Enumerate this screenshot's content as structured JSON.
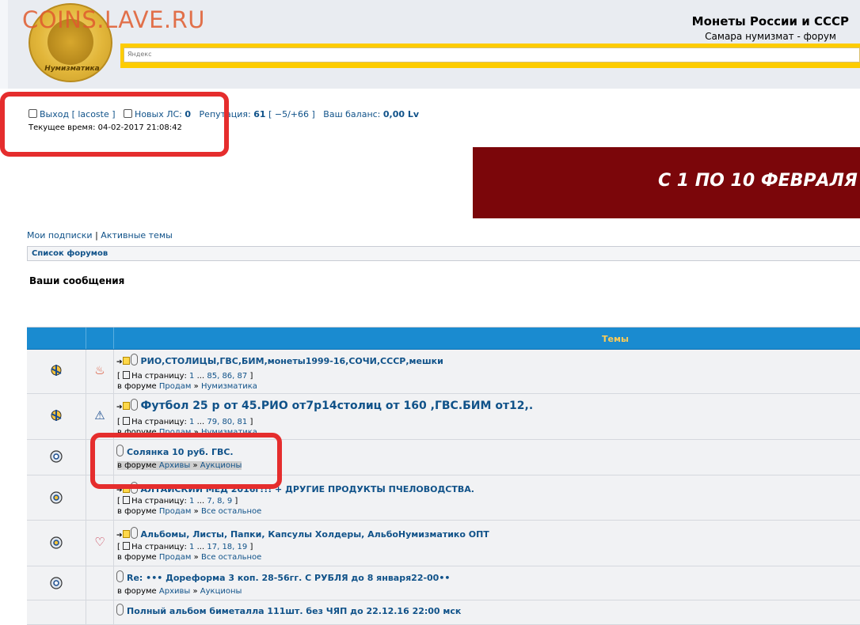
{
  "header": {
    "watermark": "COINS.LAVE.RU",
    "logo_text": "Нумизматика",
    "site_title": "Монеты России и СССР",
    "site_subtitle": "Самара нумизмат - форум",
    "search_placeholder": "Яндекс"
  },
  "user": {
    "logout_label": "Выход [ lacoste ]",
    "new_pm_label": "Новых ЛС:",
    "new_pm_count": "0",
    "reputation_label": "Репутация:",
    "reputation_value": "61",
    "reputation_detail": "[ −5/+66 ]",
    "balance_label": "Ваш баланс:",
    "balance_value": "0,00 Lv",
    "current_time": "Текущее время: 04-02-2017 21:08:42"
  },
  "banner": {
    "text": "С 1 ПО 10 ФЕВРАЛЯ"
  },
  "nav": {
    "subscriptions": "Мои подписки",
    "separator": "|",
    "active_topics": "Активные темы",
    "forum_list": "Список форумов"
  },
  "page_title": "Ваши сообщения",
  "table": {
    "header_topics": "Темы",
    "rows": [
      {
        "title": "РИО,СТОЛИЦЫ,ГВС,БИМ,монеты1999-16,СОЧИ,СССР,мешки",
        "pages_prefix": "[ ",
        "pages_label": "На страницу:",
        "pages": [
          "1",
          "...",
          "85,",
          "86,",
          "87"
        ],
        "pages_suffix": "]",
        "forum_prefix": "в форуме",
        "forum_parent": "Продам",
        "forum_sep": "»",
        "forum_child": "Нумизматика"
      },
      {
        "title": "Футбол 25 р от 45.РИО от7р14столиц от 160 ,ГВС.БИМ от12,.",
        "pages_prefix": "[ ",
        "pages_label": "На страницу:",
        "pages": [
          "1",
          "...",
          "79,",
          "80,",
          "81"
        ],
        "pages_suffix": "]",
        "forum_prefix": "в форуме",
        "forum_parent": "Продам",
        "forum_sep": "»",
        "forum_child": "Нумизматика"
      },
      {
        "title": "Солянка 10 руб. ГВС.",
        "forum_prefix": "в форуме",
        "forum_parent": "Архивы",
        "forum_sep": "»",
        "forum_child": "Аукционы"
      },
      {
        "title": "АЛТАЙСКИЙ МЁД 2016г!!! + ДРУГИЕ ПРОДУКТЫ ПЧЕЛОВОДСТВА.",
        "pages_prefix": "[ ",
        "pages_label": "На страницу:",
        "pages": [
          "1",
          "...",
          "7,",
          "8,",
          "9"
        ],
        "pages_suffix": "]",
        "forum_prefix": "в форуме",
        "forum_parent": "Продам",
        "forum_sep": "»",
        "forum_child": "Все остальное"
      },
      {
        "title": "Альбомы, Листы, Папки, Капсулы Холдеры, АльбоНумизматико ОПТ",
        "pages_prefix": "[ ",
        "pages_label": "На страницу:",
        "pages": [
          "1",
          "...",
          "17,",
          "18,",
          "19"
        ],
        "pages_suffix": "]",
        "forum_prefix": "в форуме",
        "forum_parent": "Продам",
        "forum_sep": "»",
        "forum_child": "Все остальное"
      },
      {
        "title": "Re: ••• Дореформа 3 коп. 28-56гг. С РУБЛЯ до 8 января22-00••",
        "forum_prefix": "в форуме",
        "forum_parent": "Архивы",
        "forum_sep": "»",
        "forum_child": "Аукционы"
      },
      {
        "title": "Полный альбом биметалла 111шт. без ЧЯП до 22.12.16 22:00 мск"
      }
    ]
  },
  "colors": {
    "link": "#105289",
    "header_bar": "#1a8bd0",
    "header_label": "#ffcc55",
    "banner_bg": "#7b060a",
    "yandex_bar": "#fdcc00",
    "annotation": "#e52d2d"
  }
}
